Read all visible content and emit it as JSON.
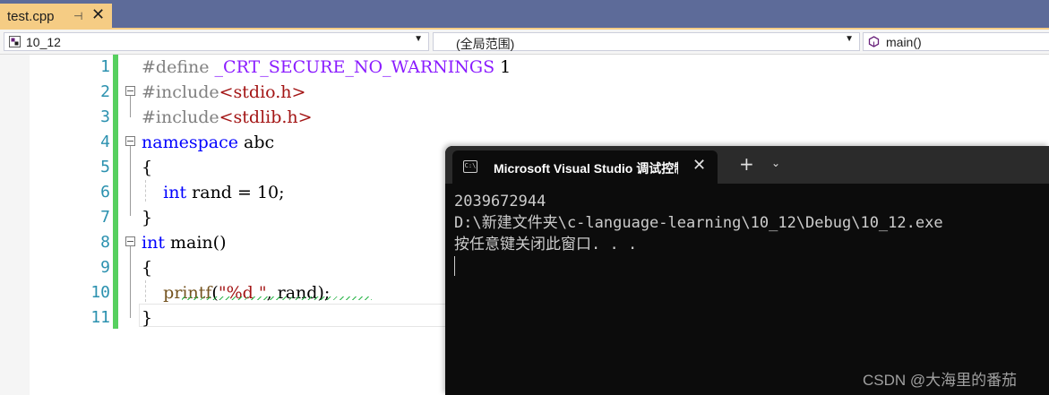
{
  "tab": {
    "title": "test.cpp",
    "pin_glyph": "⊣",
    "close_glyph": "✕"
  },
  "navbar": {
    "project": "10_12",
    "scope": "(全局范围)",
    "member": "main()"
  },
  "editor": {
    "line_numbers": [
      "1",
      "2",
      "3",
      "4",
      "5",
      "6",
      "7",
      "8",
      "9",
      "10",
      "11"
    ],
    "lines": [
      [
        {
          "t": "#define ",
          "c": "pp"
        },
        {
          "t": "_CRT_SECURE_NO_WARNINGS",
          "c": "mac"
        },
        {
          "t": " 1",
          "c": "plain"
        }
      ],
      [
        {
          "t": "#include",
          "c": "pp"
        },
        {
          "t": "<stdio.h>",
          "c": "str"
        }
      ],
      [
        {
          "t": "#include",
          "c": "pp"
        },
        {
          "t": "<stdlib.h>",
          "c": "str"
        }
      ],
      [
        {
          "t": "namespace",
          "c": "kw"
        },
        {
          "t": " abc",
          "c": "plain"
        }
      ],
      [
        {
          "t": "{",
          "c": "plain"
        }
      ],
      [
        {
          "t": "    ",
          "c": "plain"
        },
        {
          "t": "int",
          "c": "kw"
        },
        {
          "t": " rand = 10;",
          "c": "plain"
        }
      ],
      [
        {
          "t": "}",
          "c": "plain"
        }
      ],
      [
        {
          "t": "int",
          "c": "kw"
        },
        {
          "t": " main()",
          "c": "plain"
        }
      ],
      [
        {
          "t": "{",
          "c": "plain"
        }
      ],
      [
        {
          "t": "    ",
          "c": "plain"
        },
        {
          "t": "printf",
          "c": "fn"
        },
        {
          "t": "(",
          "c": "plain"
        },
        {
          "t": "\"%d \"",
          "c": "str"
        },
        {
          "t": ", rand);",
          "c": "plain"
        }
      ],
      [
        {
          "t": "}",
          "c": "plain"
        }
      ]
    ]
  },
  "terminal": {
    "tab_title": "Microsoft Visual Studio 调试控制台",
    "tab_icon_text": "C:\\",
    "close_glyph": "✕",
    "newtab_glyph": "+",
    "dropdown_glyph": "⌄",
    "output": [
      "2039672944",
      "D:\\新建文件夹\\c-language-learning\\10_12\\Debug\\10_12.exe",
      "按任意键关闭此窗口. . ."
    ]
  },
  "watermark": "CSDN @大海里的番茄",
  "colors": {
    "tabstrip": "#5d6b99",
    "active_tab": "#f5cc84",
    "changebar": "#57d05f",
    "keyword": "#0000ff",
    "string": "#a31515",
    "macro": "#8a1bff",
    "line_number": "#2b91af",
    "terminal_bg": "#0c0c0c"
  }
}
